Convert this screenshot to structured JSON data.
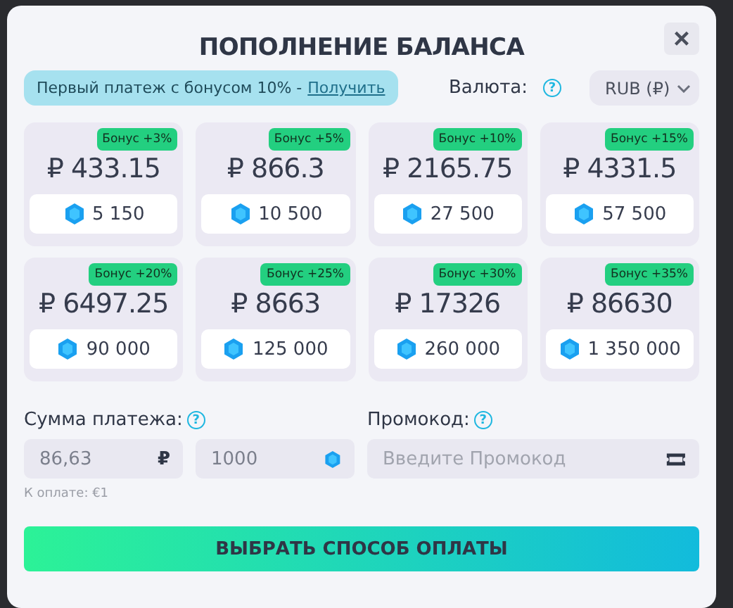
{
  "dialog": {
    "title": "ПОПОЛНЕНИЕ БАЛАНСА",
    "close": "×"
  },
  "promo_banner": {
    "text": "Первый платеж с бонусом 10% -",
    "link": "Получить"
  },
  "currency": {
    "label": "Валюта:",
    "help": "?",
    "value": "RUB (₽)"
  },
  "packages": [
    {
      "bonus": "Бонус +3%",
      "price": "₽ 433.15",
      "coins": "5 150"
    },
    {
      "bonus": "Бонус +5%",
      "price": "₽ 866.3",
      "coins": "10 500"
    },
    {
      "bonus": "Бонус +10%",
      "price": "₽ 2165.75",
      "coins": "27 500"
    },
    {
      "bonus": "Бонус +15%",
      "price": "₽ 4331.5",
      "coins": "57 500"
    },
    {
      "bonus": "Бонус +20%",
      "price": "₽ 6497.25",
      "coins": "90 000"
    },
    {
      "bonus": "Бонус +25%",
      "price": "₽ 8663",
      "coins": "125 000"
    },
    {
      "bonus": "Бонус +30%",
      "price": "₽ 17326",
      "coins": "260 000"
    },
    {
      "bonus": "Бонус +35%",
      "price": "₽ 86630",
      "coins": "1 350 000"
    }
  ],
  "amount": {
    "label": "Сумма платежа:",
    "help": "?",
    "value": "86,63",
    "currency_sign": "₽",
    "coins_value": "1000",
    "to_pay": "К оплате: €1"
  },
  "promocode": {
    "label": "Промокод:",
    "help": "?",
    "placeholder": "Введите Промокод"
  },
  "submit": "ВЫБРАТЬ СПОСОБ ОПЛАТЫ"
}
